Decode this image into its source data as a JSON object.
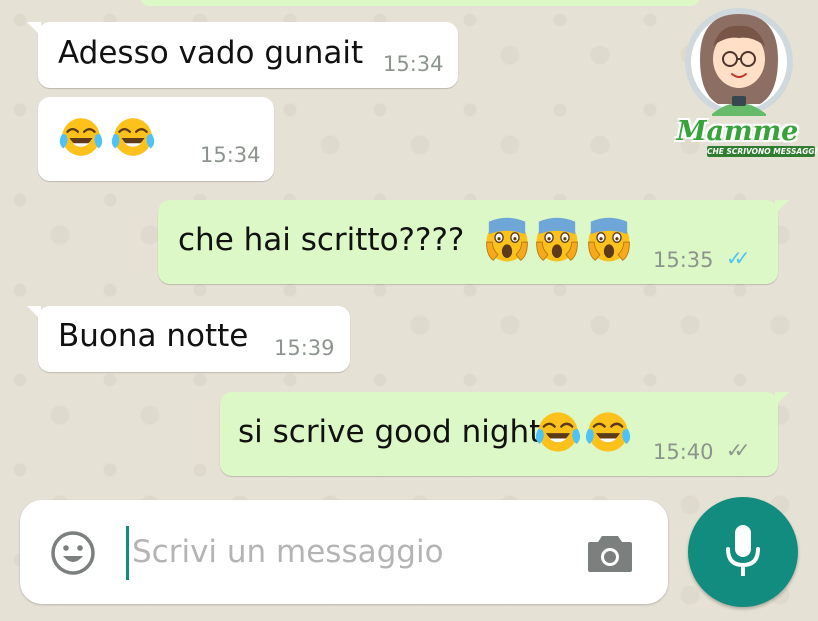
{
  "branding": {
    "logo_title": "Mamme",
    "logo_subtitle": "CHE SCRIVONO MESSAGGI",
    "logo_color": "#37a33a"
  },
  "colors": {
    "incoming_bubble": "#ffffff",
    "outgoing_bubble": "#dcf8c6",
    "wallpaper": "#e6e1d5",
    "mic_button": "#128c7e",
    "read_ticks": "#4fc3f7",
    "delivered_ticks": "#8d948d"
  },
  "messages": [
    {
      "direction": "incoming",
      "text": "Adesso vado gunait",
      "time": "15:34"
    },
    {
      "direction": "incoming",
      "text": "",
      "emojis": [
        "face-with-tears-of-joy",
        "face-with-tears-of-joy"
      ],
      "time": "15:34"
    },
    {
      "direction": "outgoing",
      "text": "che hai scritto????",
      "emojis": [
        "face-screaming-in-fear",
        "face-screaming-in-fear",
        "face-screaming-in-fear"
      ],
      "time": "15:35",
      "status": "read",
      "status_icon": "double-check-blue-icon"
    },
    {
      "direction": "incoming",
      "text": "Buona notte",
      "time": "15:39"
    },
    {
      "direction": "outgoing",
      "text": "si scrive good night",
      "emojis": [
        "face-with-tears-of-joy",
        "face-with-tears-of-joy"
      ],
      "time": "15:40",
      "status": "delivered",
      "status_icon": "double-check-grey-icon"
    }
  ],
  "composer": {
    "placeholder": "Scrivi un messaggio",
    "emoji_icon": "smiley-icon",
    "camera_icon": "camera-icon",
    "mic_icon": "microphone-icon"
  }
}
